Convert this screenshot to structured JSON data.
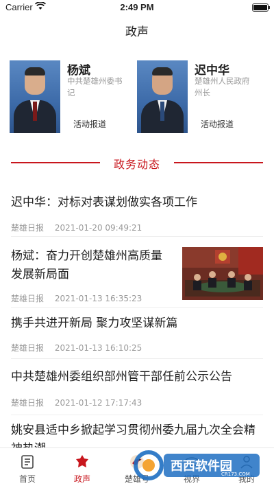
{
  "status_bar": {
    "carrier": "Carrier",
    "time": "2:49 PM"
  },
  "nav": {
    "title": "政声"
  },
  "leaders": [
    {
      "name": "杨斌",
      "title": "中共楚雄州委书记",
      "link": "活动报道"
    },
    {
      "name": "迟中华",
      "title": "楚雄州人民政府州长",
      "link": "活动报道"
    }
  ],
  "section": {
    "title": "政务动态"
  },
  "news": [
    {
      "headline": "迟中华：对标对表谋划做实各项工作",
      "source": "楚雄日报",
      "datetime": "2021-01-20 09:49:21"
    },
    {
      "headline": "杨斌：奋力开创楚雄州高质量发展新局面",
      "source": "楚雄日报",
      "datetime": "2021-01-13 16:35:23",
      "has_image": true
    },
    {
      "headline": "携手共进开新局 聚力攻坚谋新篇",
      "source": "楚雄日报",
      "datetime": "2021-01-13 16:10:25"
    },
    {
      "headline": "中共楚雄州委组织部州管干部任前公示公告",
      "source": "楚雄日报",
      "datetime": "2021-01-12 17:17:43"
    },
    {
      "headline": "姚安县适中乡掀起学习贯彻州委九届九次全会精神热潮"
    }
  ],
  "tabs": [
    {
      "label": "首页",
      "icon": "home-icon"
    },
    {
      "label": "政声",
      "icon": "flag-icon",
      "active": true
    },
    {
      "label": "楚雄号",
      "icon": "bird-logo-icon"
    },
    {
      "label": "视界",
      "icon": "eye-icon"
    },
    {
      "label": "我的",
      "icon": "user-icon"
    }
  ],
  "watermark": {
    "text": "西西软件园",
    "url_text": "CR173.COM"
  },
  "colors": {
    "accent": "#c8161d",
    "muted": "#999999"
  }
}
